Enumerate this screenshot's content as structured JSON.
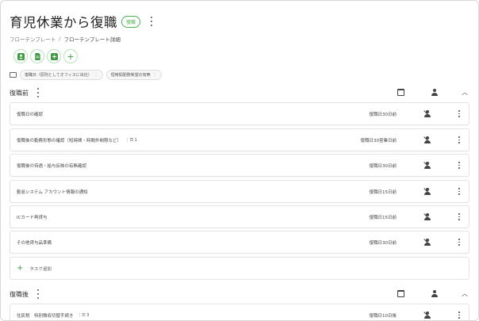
{
  "page": {
    "title": "育児休業から復職",
    "badge": "復職",
    "breadcrumb": [
      "フローテンプレート",
      "/",
      "フローテンプレート詳細"
    ]
  },
  "toolbar": {
    "icons": [
      "person-icon",
      "document-icon",
      "add-box-icon",
      "plus-icon"
    ]
  },
  "tags": {
    "chips": [
      "復職日（原則としてオフィスに出社）",
      "短時間勤務希望の有無"
    ]
  },
  "sections": [
    {
      "title": "復職前",
      "tasks": [
        {
          "name": "復職日の確認",
          "subtasks": "",
          "due": "復職日30日前"
        },
        {
          "name": "復職後の勤務形態の確認（短時間・時間外制限など）",
          "subtasks": "1",
          "due": "復職日30営業日前"
        },
        {
          "name": "復職後の待遇・給与反映の有無確認",
          "subtasks": "",
          "due": "復職日30日前"
        },
        {
          "name": "勤怠システム アカウント情報の通知",
          "subtasks": "",
          "due": "復職日15日前"
        },
        {
          "name": "ICカード再貸与",
          "subtasks": "",
          "due": "復職日15日前"
        },
        {
          "name": "その他貸与品準備",
          "subtasks": "",
          "due": "復職日30日前"
        }
      ],
      "add_label": "タスク追加"
    },
    {
      "title": "復職後",
      "tasks": [
        {
          "name": "住民税　特別徴収切替手続き",
          "subtasks": "3",
          "due": "復職日10日後"
        }
      ]
    }
  ]
}
